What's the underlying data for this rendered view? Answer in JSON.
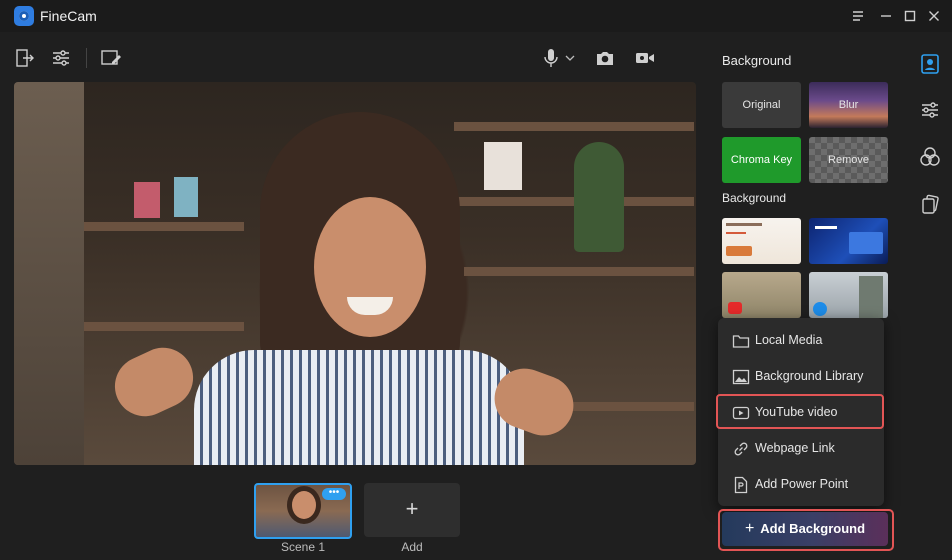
{
  "app": {
    "title": "FineCam"
  },
  "window_controls": {
    "menu_icon": "hamburger-icon",
    "minimize_icon": "minimize-icon",
    "maximize_icon": "maximize-icon",
    "close_icon": "close-icon"
  },
  "toolbar": {
    "left_icons": [
      "exit-icon",
      "adjust-sliders-icon",
      "whiteboard-icon"
    ],
    "center_icons": [
      "microphone-icon",
      "chevron-down-icon",
      "camera-icon",
      "video-record-icon"
    ]
  },
  "scenes": {
    "items": [
      {
        "label": "Scene 1",
        "more": "•••"
      }
    ],
    "add": {
      "symbol": "+",
      "label": "Add"
    }
  },
  "panel": {
    "title": "Background",
    "effects": {
      "original": "Original",
      "blur": "Blur",
      "chroma_key": "Chroma Key",
      "remove": "Remove"
    },
    "section_label": "Background"
  },
  "side_rail": {
    "icons": [
      "person-portrait-icon",
      "sliders-icon",
      "overlay-circles-icon",
      "layers-icon"
    ]
  },
  "menu": {
    "items": [
      {
        "label": "Local Media",
        "icon": "folder-icon"
      },
      {
        "label": "Background Library",
        "icon": "image-icon"
      },
      {
        "label": "YouTube video",
        "icon": "play-video-icon"
      },
      {
        "label": "Webpage Link",
        "icon": "link-icon"
      },
      {
        "label": "Add Power Point",
        "icon": "powerpoint-file-icon"
      }
    ],
    "highlighted": "YouTube video"
  },
  "add_background": {
    "symbol": "+",
    "label": "Add Background"
  },
  "colors": {
    "accent": "#2fa0f0",
    "chroma_green": "#1f9a2b",
    "highlight_red": "#e25555"
  }
}
